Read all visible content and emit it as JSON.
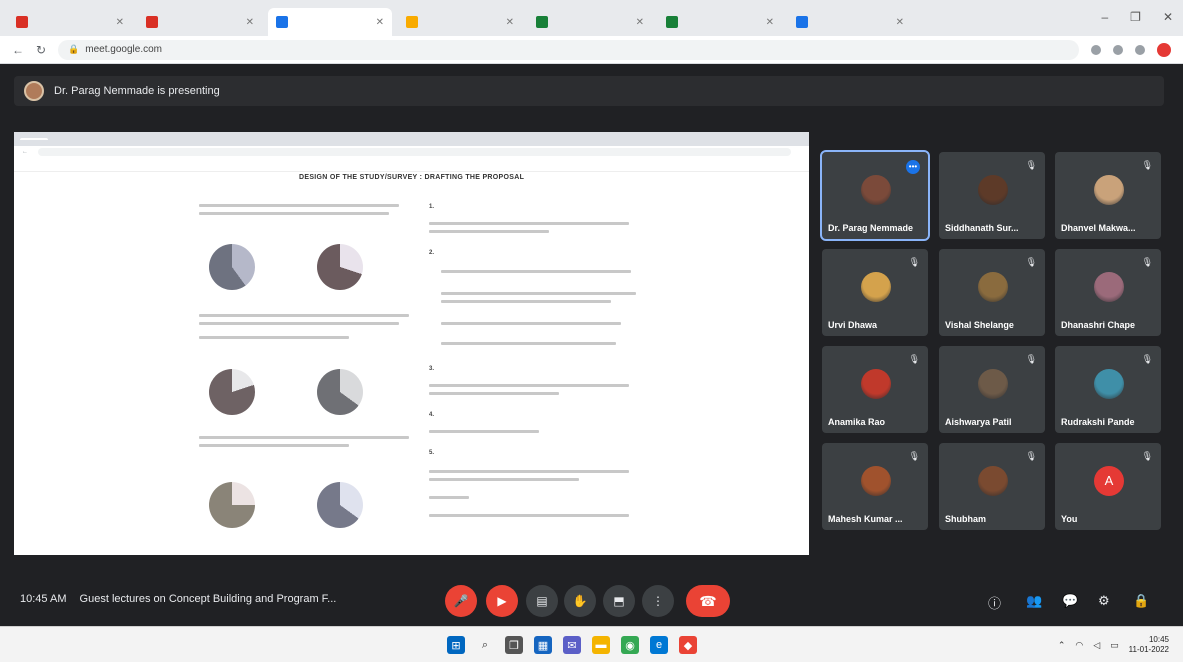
{
  "browser": {
    "tabs": [
      {
        "label": "",
        "color": "#d93025"
      },
      {
        "label": "",
        "color": "#d93025"
      },
      {
        "label": "",
        "color": "#1a73e8"
      },
      {
        "label": "",
        "color": "#f9ab00"
      },
      {
        "label": "",
        "color": "#188038"
      },
      {
        "label": "",
        "color": "#188038"
      },
      {
        "label": "",
        "color": "#1a73e8"
      }
    ],
    "url": "meet.google.com"
  },
  "meet": {
    "presenting_text": "Dr. Parag Nemmade is presenting",
    "shared_doc_title": "DESIGN OF THE STUDY/SURVEY : DRAFTING THE PROPOSAL",
    "shared_sections": [
      "1.",
      "2.",
      "3.",
      "4.",
      "5."
    ],
    "participants": [
      {
        "name": "Dr. Parag Nemmade",
        "speaking": true,
        "color": "#7b4a3a"
      },
      {
        "name": "Siddhanath Sur...",
        "speaking": false,
        "color": "#5d3a28"
      },
      {
        "name": "Dhanvel Makwa...",
        "speaking": false,
        "color": "#c9a27a"
      },
      {
        "name": "Urvi Dhawa",
        "speaking": false,
        "color": "#d4a24c"
      },
      {
        "name": "Vishal Shelange",
        "speaking": false,
        "color": "#8a6b3e"
      },
      {
        "name": "Dhanashri Chape",
        "speaking": false,
        "color": "#9b6a7a"
      },
      {
        "name": "Anamika Rao",
        "speaking": false,
        "color": "#c0392b"
      },
      {
        "name": "Aishwarya Patil",
        "speaking": false,
        "color": "#6d5a48"
      },
      {
        "name": "Rudrakshi Pande",
        "speaking": false,
        "color": "#3f8fa8"
      },
      {
        "name": "Mahesh Kumar ...",
        "speaking": false,
        "color": "#a0522d"
      },
      {
        "name": "Shubham",
        "speaking": false,
        "color": "#7a4a30"
      },
      {
        "name": "You",
        "speaking": false,
        "letter": "A",
        "color": "#e53935"
      }
    ],
    "time": "10:45 AM",
    "meeting_title": "Guest lectures on Concept Building and Program F..."
  },
  "taskbar": {
    "clock_time": "10:45",
    "clock_date": "11-01-2022"
  }
}
